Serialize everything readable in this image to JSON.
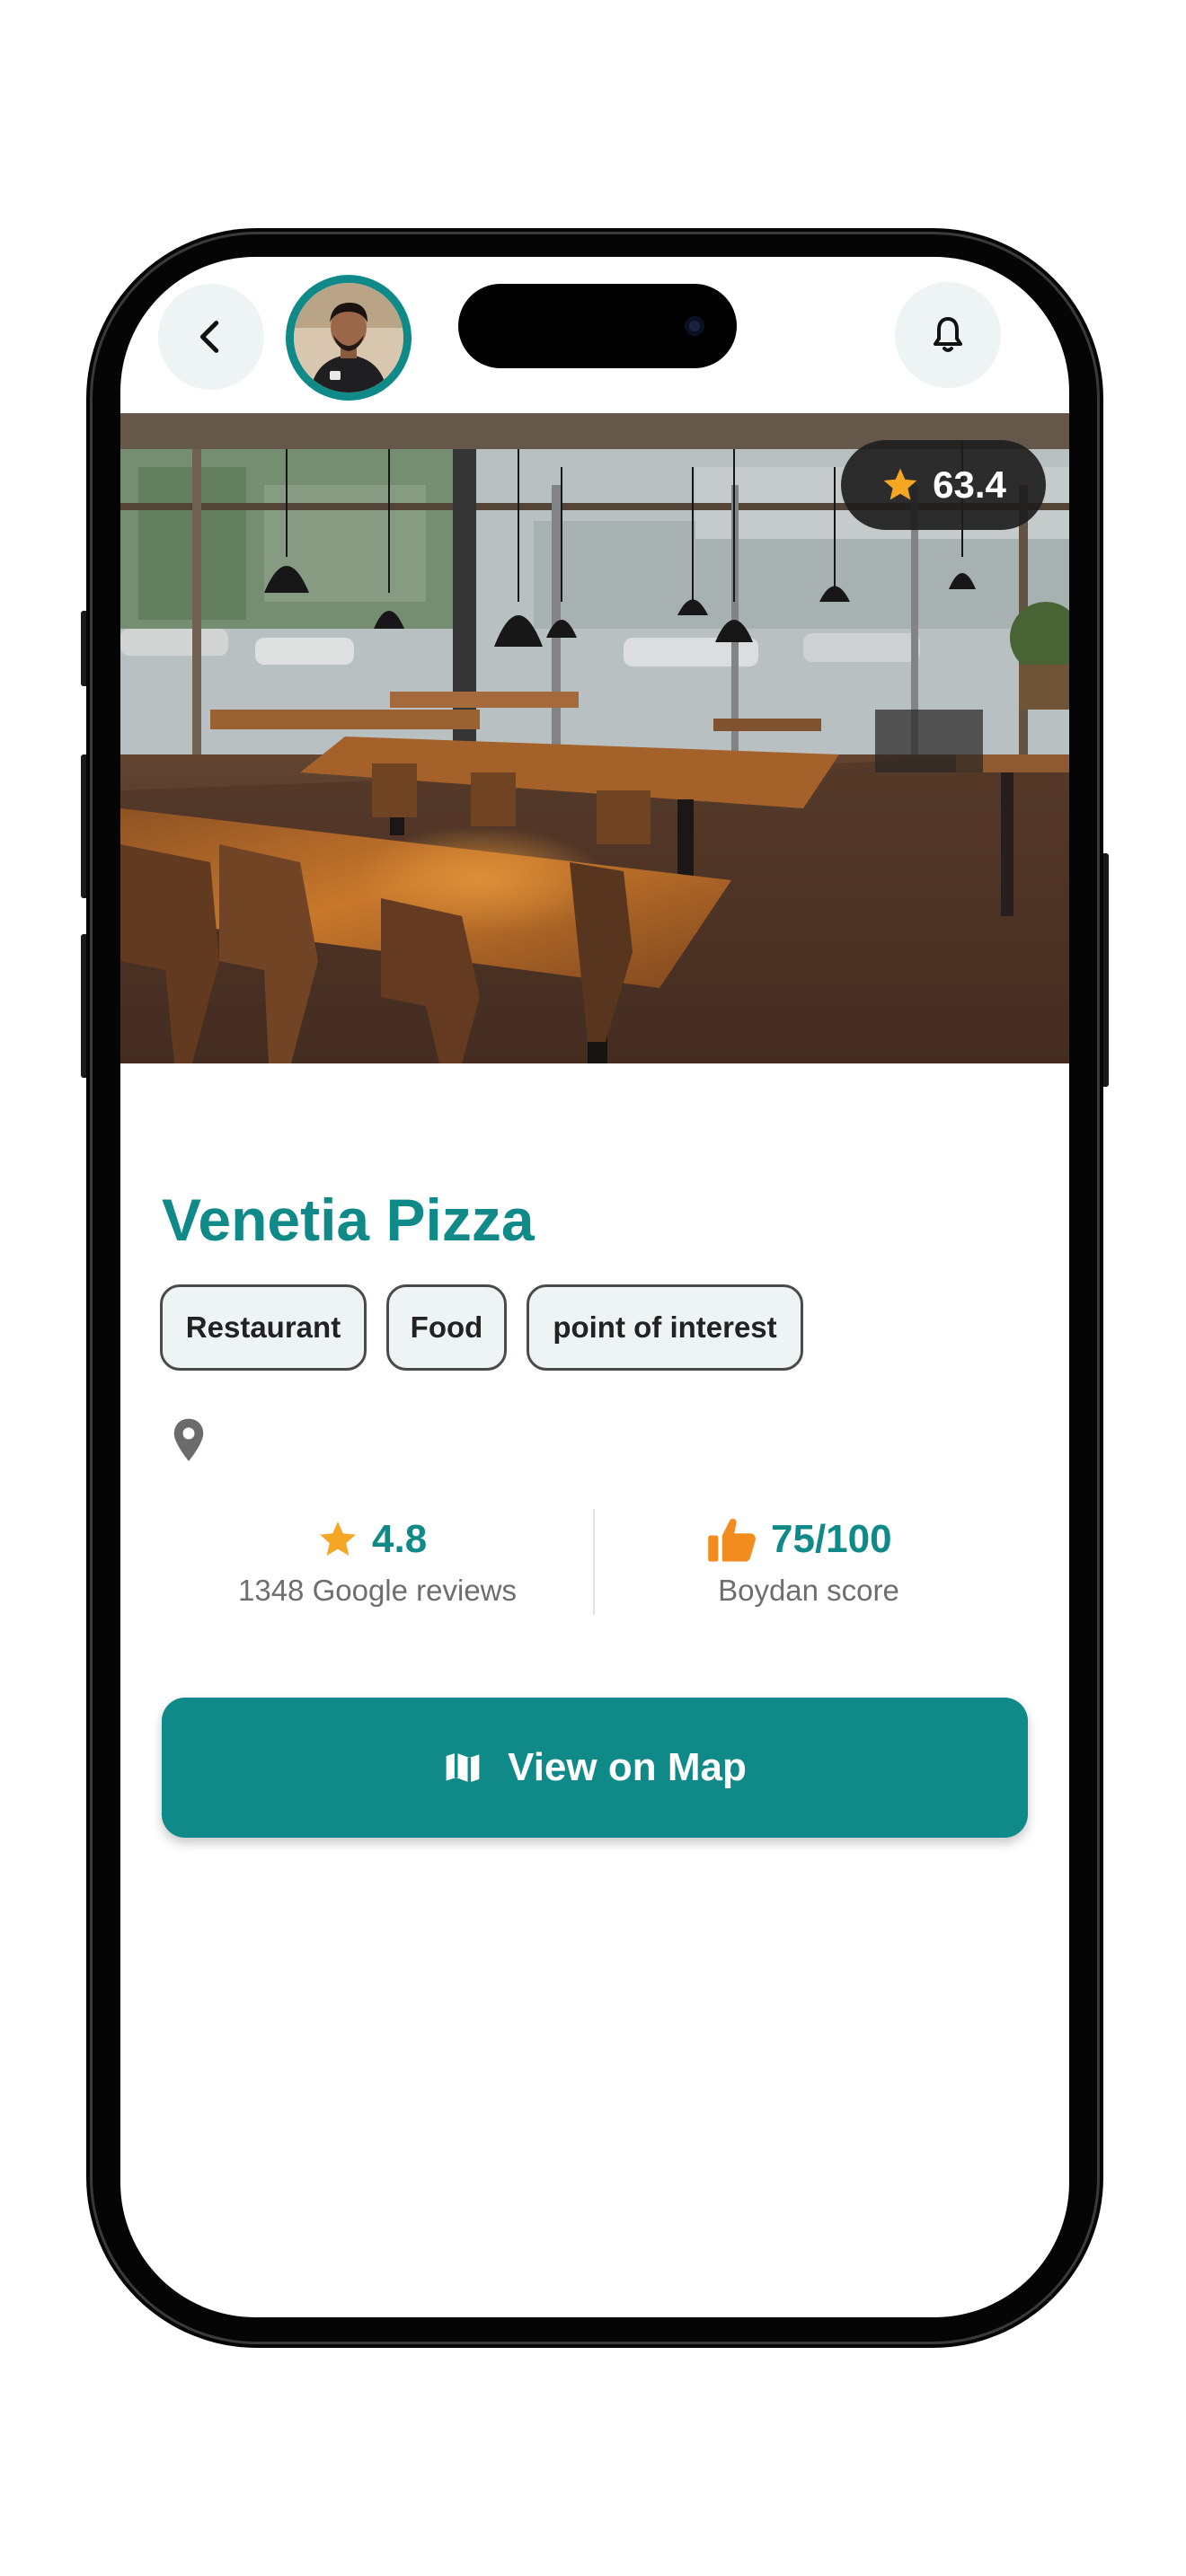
{
  "header": {
    "back_icon": "chevron-left-icon",
    "notification_icon": "bell-icon"
  },
  "hero": {
    "rating": "63.4"
  },
  "place": {
    "name": "Venetia Pizza",
    "tags": [
      "Restaurant",
      "Food",
      "point of interest"
    ]
  },
  "stats": {
    "google_rating": "4.8",
    "google_reviews": "1348 Google reviews",
    "boydan_score": "75/100",
    "boydan_label": "Boydan score"
  },
  "actions": {
    "view_on_map": "View on Map"
  },
  "colors": {
    "accent": "#0F8A88",
    "star": "#F5A623",
    "thumb": "#F28C1E"
  }
}
